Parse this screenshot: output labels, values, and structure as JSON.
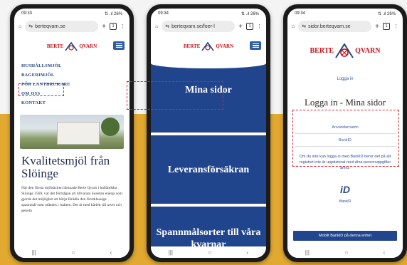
{
  "colors": {
    "accent": "#21458d",
    "highlight": "#d7222b",
    "brand_red": "#c4151c",
    "background_gold": "#e2a930"
  },
  "phone1": {
    "status_time": "09:33",
    "status_right": "⇅ .ıl 26%",
    "url": "berteqvarn.se",
    "tabs_count": "1",
    "menu": [
      "HUSHÅLLSMJÖL",
      "BAGERIMJÖL",
      "FÖR LANTBRUKARE",
      "OM OSS",
      "KONTAKT"
    ],
    "headline": "Kvalitetsmjöl från Slöinge",
    "paragraph": "När den första mjölsäcken lämnade Berte Qvarn i halländska Slöinge 1569, var det förmågan att tillvarata Suseåns energi som gjorde det möjlighet att börja förädla den förstklassiga spannmål som odlades i trakten. Det är med kärlek till arvet och genuin"
  },
  "phone2": {
    "status_time": "09:34",
    "status_right": "⇅ .ıl 26%",
    "url": "berteqvarn.se/foer-l",
    "tabs_count": "1",
    "panels": [
      "Mina sidor",
      "Leveransförsäkran",
      "Spannmålsorter till våra kvarnar"
    ]
  },
  "phone3": {
    "status_time": "09:34",
    "status_right": "⇅ .ıl 26%",
    "url": "sidor.berteqvarn.se",
    "tabs_count": "1",
    "login_link": "Logga in",
    "title": "Logga in - Mina sidor",
    "fields": [
      "Användarnamn",
      "BankID"
    ],
    "notice": "Om du inte kan logga in med BankID beror det på att registret inte är uppdaterat med dina personuppgifter ännu.",
    "bankid_word": "BankID",
    "bankid_button": "Mobilt BankID på denna enhet"
  },
  "brand": {
    "left": "BERTE",
    "right": "QVARN"
  },
  "nav_glyphs": {
    "recents": "|||",
    "home": "○",
    "back": "‹"
  },
  "icons": {
    "home": "⌂",
    "tune": "⇆",
    "plus": "+",
    "more": "⋮"
  }
}
